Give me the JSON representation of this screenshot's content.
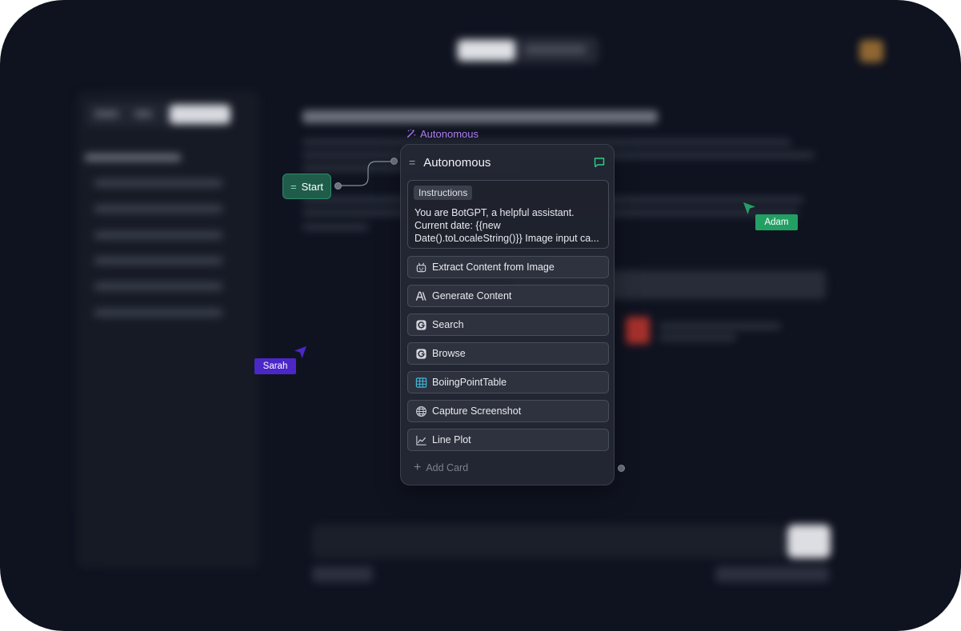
{
  "workflow": {
    "start_node": {
      "label": "Start"
    },
    "agent_tag": {
      "label": "Autonomous"
    },
    "agent_panel": {
      "title": "Autonomous",
      "instructions": {
        "label": "Instructions",
        "text": "You are BotGPT, a helpful assistant.\nCurrent date: {{new Date().toLocaleString()}} Image input ca..."
      },
      "tools": [
        {
          "label": "Extract Content from Image",
          "icon": "robot-icon"
        },
        {
          "label": "Generate Content",
          "icon": "anthropic-icon"
        },
        {
          "label": "Search",
          "icon": "google-search-icon"
        },
        {
          "label": "Browse",
          "icon": "google-browse-icon"
        },
        {
          "label": "BoiingPointTable",
          "icon": "table-icon"
        },
        {
          "label": "Capture Screenshot",
          "icon": "globe-icon"
        },
        {
          "label": "Line Plot",
          "icon": "line-chart-icon"
        }
      ],
      "add_card_label": "Add Card"
    }
  },
  "collaborators": [
    {
      "name": "Adam",
      "color": "#22a064"
    },
    {
      "name": "Sarah",
      "color": "#4b27c7"
    }
  ],
  "colors": {
    "start_node": "#1f5d4a",
    "agent_accent": "#b17ff5",
    "chat_icon": "#2ecf86",
    "table_icon": "#3fb8d6"
  }
}
